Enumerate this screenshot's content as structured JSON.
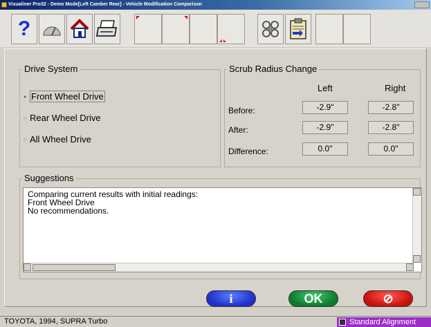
{
  "window": {
    "title": "Visualiner Pro32 - Demo Mode[Left Camber Rear] - Vehicle Modification Comparison"
  },
  "toolbar": {
    "buttons": [
      {
        "name": "help",
        "icon": "help-icon"
      },
      {
        "name": "gauge",
        "icon": "gauge-icon"
      },
      {
        "name": "home",
        "icon": "home-icon"
      },
      {
        "name": "print",
        "icon": "printer-icon"
      },
      {
        "name": "blank-1",
        "icon": "red-corner-marker-icon"
      },
      {
        "name": "blank-2",
        "icon": "red-corner-marker-icon"
      },
      {
        "name": "blank-3",
        "icon": "red-corner-marker-icon"
      },
      {
        "name": "wheel-compare",
        "icon": "wheel-sensors-icon"
      },
      {
        "name": "clipboard",
        "icon": "clipboard-import-icon"
      }
    ]
  },
  "drive_system": {
    "title": "Drive System",
    "options": [
      {
        "label": "Front Wheel Drive",
        "selected": true
      },
      {
        "label": "Rear Wheel Drive",
        "selected": false
      },
      {
        "label": "All Wheel Drive",
        "selected": false
      }
    ]
  },
  "scrub": {
    "title": "Scrub Radius Change",
    "col_left": "Left",
    "col_right": "Right",
    "rows": [
      {
        "label": "Before:",
        "left": "-2.9\"",
        "right": "-2.8\""
      },
      {
        "label": "After:",
        "left": "-2.9\"",
        "right": "-2.8\""
      },
      {
        "label": "Difference:",
        "left": "0.0\"",
        "right": "0.0\""
      }
    ]
  },
  "suggestions": {
    "title": "Suggestions",
    "lines": [
      "Comparing current results with initial readings:",
      "Front Wheel Drive",
      "No recommendations."
    ]
  },
  "actions": {
    "info_label": "i",
    "ok_label": "OK",
    "cancel_label": "⊘"
  },
  "status": {
    "vehicle": "TOYOTA, 1994, SUPRA Turbo",
    "mode": "Standard Alignment"
  }
}
